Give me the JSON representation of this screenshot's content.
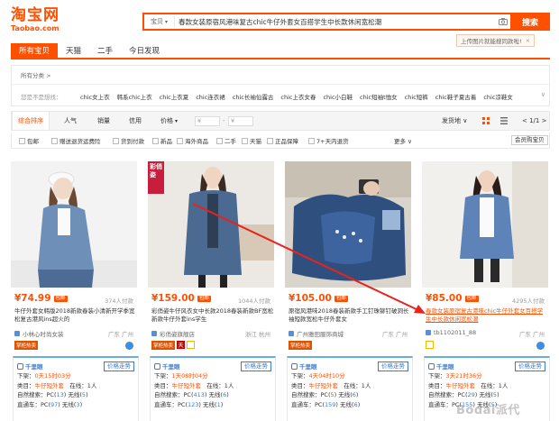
{
  "logo": {
    "cn": "淘宝网",
    "en": "Taobao.com"
  },
  "search": {
    "scope": "宝贝",
    "query": "春款女装原宿风港味复古chic牛仔外套女百搭学生中长款休闲宽松潮",
    "button": "搜索",
    "tip": "上传图片就能搜同款啦!",
    "tip_close": "×"
  },
  "tabs": [
    "所有宝贝",
    "天猫",
    "二手",
    "今日发现"
  ],
  "category": {
    "crumb": "所有分类 >",
    "label": "您是不是想找：",
    "items": [
      "chic女上衣",
      "韩系chic上衣",
      "chic上衣夏",
      "chic连衣裙",
      "chic长袖仙露古",
      "chic上衣女春",
      "chic小白鞋",
      "chic短袖t恤女",
      "chic短裤",
      "chic鞋子夏古着",
      "chic凉鞋女"
    ],
    "more": "∨"
  },
  "sort": {
    "items": [
      "综合排序",
      "人气",
      "销量",
      "信用",
      "价格"
    ],
    "price_from": "¥",
    "price_to": "¥",
    "dash": "-",
    "ship_from": "发货地 ∨",
    "page": "< 1/1 >"
  },
  "filters": {
    "items": [
      "包邮",
      "赠送退货运费险",
      "货到付款",
      "新品",
      "海外商品",
      "二手",
      "天猫",
      "正品保障",
      "7+天内退货"
    ],
    "more": "更多 ∨",
    "pay": "会员购宝贝"
  },
  "products": [
    {
      "price": "¥74.99",
      "ship_tag": "包邮",
      "paid": "374人付款",
      "title": "牛仔外套女韩版2018新款春装小清新开学季宽松复古港风ins超火的",
      "shop": "小林心时尚女装",
      "location": "广东 广州",
      "badge": "掌柜热卖",
      "plug": {
        "brand": "千里眼",
        "btn": "价格走势",
        "deal_label": "下架：",
        "deal": "0天15时03分",
        "cat_label": "类目：",
        "cat": "牛仔短外套",
        "own": "在线：1人",
        "nat_label": "自然搜索：PC(",
        "nat_pc": "13",
        "nat_mid": ") 无线(",
        "nat_mob": "5",
        "ads_label": "直通车：PC(",
        "ads_pc": "97",
        "ads_mid": ") 无线(",
        "ads_mob": "3"
      }
    },
    {
      "price": "¥159.00",
      "ship_tag": "包邮",
      "paid": "1044人付款",
      "title": "彩俏姿牛仔风衣女中长款2018春装新款BF宽松新款牛仔外套ins学生",
      "shop": "彩俏姿旗舰店",
      "location": "浙江 杭州",
      "badge": "掌柜热卖",
      "img_label": "彩俏姿",
      "plug": {
        "brand": "千里眼",
        "btn": "价格走势",
        "deal_label": "下架：",
        "deal": "1天08时04分",
        "cat_label": "类目：",
        "cat": "牛仔短外套",
        "own": "在线：1人",
        "nat_label": "自然搜索：PC(",
        "nat_pc": "413",
        "nat_mid": ") 无线(",
        "nat_mob": "6",
        "ads_label": "直通车：PC(",
        "ads_pc": "123",
        "ads_mid": ") 无线(",
        "ads_mob": "1"
      }
    },
    {
      "price": "¥105.00",
      "ship_tag": "包邮",
      "paid": "",
      "title": "原宿风港味2018春装新款手工钉珠铆钉破洞长袖短款宽松牛仔外套女",
      "shop": "广州雅田服饰商城",
      "location": "广东 广州",
      "badge": "掌柜热卖",
      "plug": {
        "brand": "千里眼",
        "btn": "价格走势",
        "deal_label": "下架：",
        "deal": "4天04时10分",
        "cat_label": "类目：",
        "cat": "牛仔短外套",
        "own": "在线：1人",
        "nat_label": "自然搜索：PC(",
        "nat_pc": "5",
        "nat_mid": ") 无线(",
        "nat_mob": "6",
        "ads_label": "直通车：PC(",
        "ads_pc": "159",
        "ads_mid": ") 无线(",
        "ads_mob": "6"
      }
    },
    {
      "price": "¥85.00",
      "ship_tag": "包邮",
      "paid": "4295人付款",
      "title": "春款女装原宿复古港味chic牛仔外套女百搭学生中长款休闲宽松潮",
      "shop": "tb1102011_88",
      "location": "广东 广州",
      "badge": "",
      "plug": {
        "brand": "千里眼",
        "btn": "价格走势",
        "deal_label": "下架：",
        "deal": "3天21时36分",
        "cat_label": "类目：",
        "cat": "牛仔短外套",
        "own": "在线：1人",
        "nat_label": "自然搜索：PC(",
        "nat_pc": "29",
        "nat_mid": ") 无线(",
        "nat_mob": "5",
        "ads_label": "直通车：PC(",
        "ads_pc": "155",
        "ads_mid": ") 无线(",
        "ads_mob": "5"
      }
    }
  ],
  "watermark": "Bodai派代",
  "colors": {
    "accent": "#ff5000",
    "link": "#3b7bd0"
  }
}
